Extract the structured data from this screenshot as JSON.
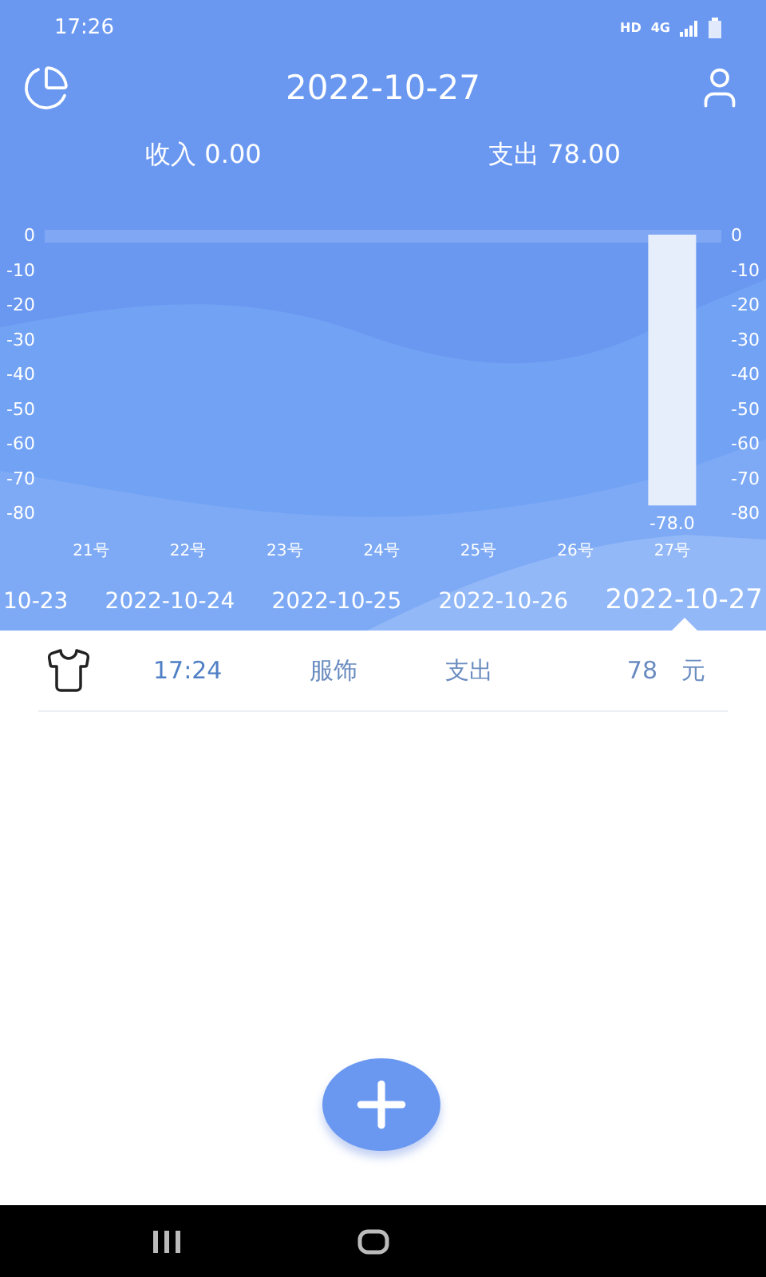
{
  "status_bar": {
    "time": "17:26",
    "hd": "HD",
    "network": "4G"
  },
  "header": {
    "title": "2022-10-27"
  },
  "totals": {
    "income": "收入 0.00",
    "expense": "支出 78.00"
  },
  "chart": {
    "right_axis_labels": [
      "0",
      "-10",
      "-20",
      "-30",
      "-40",
      "-50",
      "-60",
      "-70",
      "-80"
    ],
    "chart_data": {
      "type": "bar",
      "categories": [
        "21号",
        "22号",
        "23号",
        "24号",
        "25号",
        "26号",
        "27号"
      ],
      "values": [
        0,
        0,
        0,
        0,
        0,
        0,
        -78
      ],
      "ylim": [
        -80,
        0
      ],
      "yticks": [
        0,
        -10,
        -20,
        -30,
        -40,
        -50,
        -60,
        -70,
        -80
      ],
      "value_labels": [
        null,
        null,
        null,
        null,
        null,
        null,
        "-78.0"
      ]
    }
  },
  "dates": [
    {
      "label": "10-23",
      "selected": false
    },
    {
      "label": "2022-10-24",
      "selected": false
    },
    {
      "label": "2022-10-25",
      "selected": false
    },
    {
      "label": "2022-10-26",
      "selected": false
    },
    {
      "label": "2022-10-27",
      "selected": true
    }
  ],
  "records": [
    {
      "time": "17:24",
      "category": "服饰",
      "type": "支出",
      "amount": "78",
      "unit": "元"
    }
  ]
}
